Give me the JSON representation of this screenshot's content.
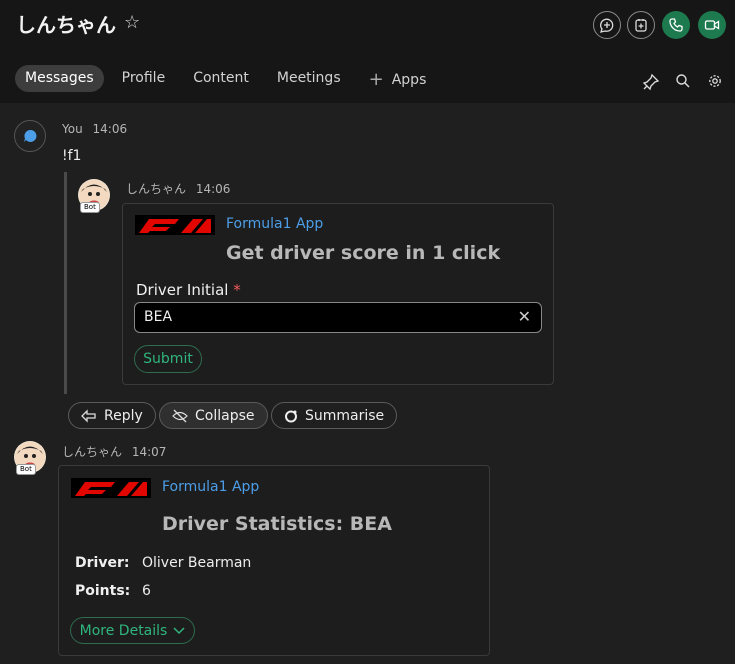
{
  "header": {
    "title": "しんちゃん",
    "star_icon": "star-icon",
    "actions": [
      "new-space-icon",
      "add-app-icon",
      "call-icon",
      "video-icon"
    ],
    "accent": "#1d7a4f"
  },
  "tabs": [
    {
      "label": "Messages",
      "active": true
    },
    {
      "label": "Profile"
    },
    {
      "label": "Content"
    },
    {
      "label": "Meetings"
    },
    {
      "label": "Apps",
      "icon": "plus-icon"
    }
  ],
  "toolbar_icons": [
    "pin-icon",
    "search-icon",
    "gear-icon"
  ],
  "messages": {
    "user": {
      "author": "You",
      "time": "14:06",
      "text": "!f1"
    },
    "bot_reply": {
      "author": "しんちゃん",
      "time": "14:06",
      "bot_tag": "Bot",
      "card": {
        "app_name": "Formula1 App",
        "title": "Get driver score in 1 click",
        "field_label": "Driver Initial",
        "required_mark": "*",
        "field_value": "BEA",
        "submit_label": "Submit"
      }
    },
    "actions": {
      "reply": "Reply",
      "collapse": "Collapse",
      "summarise": "Summarise"
    },
    "bot_stats": {
      "author": "しんちゃん",
      "time": "14:07",
      "bot_tag": "Bot",
      "card": {
        "app_name": "Formula1 App",
        "title": "Driver Statistics: BEA",
        "driver_key": "Driver:",
        "driver_value": "Oliver Bearman",
        "points_key": "Points:",
        "points_value": "6",
        "more_label": "More Details"
      }
    }
  }
}
